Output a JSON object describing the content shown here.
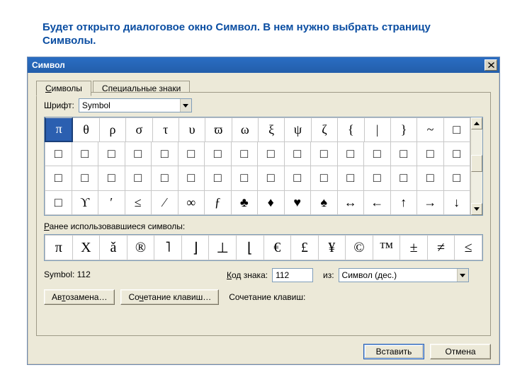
{
  "caption": "Будет открыто диалоговое окно Символ. В нем нужно выбрать страницу Символы.",
  "dialog": {
    "title": "Символ",
    "tabs": {
      "symbols": "Символы",
      "special": "Специальные знаки"
    },
    "font_label": "Шрифт:",
    "font_value": "Symbol",
    "grid": [
      [
        "π",
        "θ",
        "ρ",
        "σ",
        "τ",
        "υ",
        "ϖ",
        "ω",
        "ξ",
        "ψ",
        "ζ",
        "{",
        "|",
        "}",
        "~",
        "□"
      ],
      [
        "□",
        "□",
        "□",
        "□",
        "□",
        "□",
        "□",
        "□",
        "□",
        "□",
        "□",
        "□",
        "□",
        "□",
        "□",
        "□"
      ],
      [
        "□",
        "□",
        "□",
        "□",
        "□",
        "□",
        "□",
        "□",
        "□",
        "□",
        "□",
        "□",
        "□",
        "□",
        "□",
        "□"
      ],
      [
        "□",
        "ϒ",
        "′",
        "≤",
        "⁄",
        "∞",
        "ƒ",
        "♣",
        "♦",
        "♥",
        "♠",
        "↔",
        "←",
        "↑",
        "→",
        "↓"
      ]
    ],
    "selected": {
      "row": 0,
      "col": 0
    },
    "recent_label": "Ранее использовавшиеся символы:",
    "recent": [
      "π",
      "Χ",
      "ǎ",
      "®",
      "˥",
      "⌋",
      "⊥",
      "⌊",
      "€",
      "£",
      "¥",
      "©",
      "™",
      "±",
      "≠",
      "≤"
    ],
    "status_label": "Symbol: 112",
    "code_label": "Код знака:",
    "code_value": "112",
    "from_label": "из:",
    "from_value": "Символ (дес.)",
    "autocorrect": "Автозамена…",
    "shortcut_btn": "Сочетание клавиш…",
    "shortcut_lbl": "Сочетание клавиш:",
    "insert": "Вставить",
    "cancel": "Отмена"
  }
}
